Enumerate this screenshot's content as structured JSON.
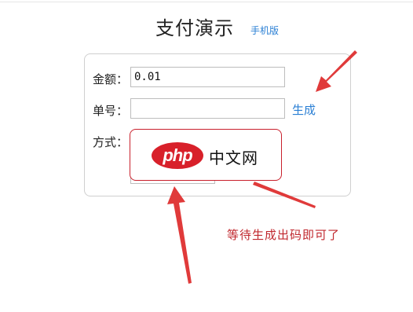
{
  "header": {
    "title": "支付演示",
    "mobile_link": "手机版"
  },
  "form": {
    "amount_label": "金额：",
    "amount_value": "0.01",
    "order_label": "单号：",
    "order_value": "",
    "generate_label": "生成",
    "method_label": "方式："
  },
  "watermark": {
    "badge": "php",
    "text": "中文网"
  },
  "annotation": {
    "note": "等待生成出码即可了"
  },
  "colors": {
    "link": "#2a7fd4",
    "annotation_red": "#c0282e",
    "arrow_red": "#e03a3a"
  }
}
